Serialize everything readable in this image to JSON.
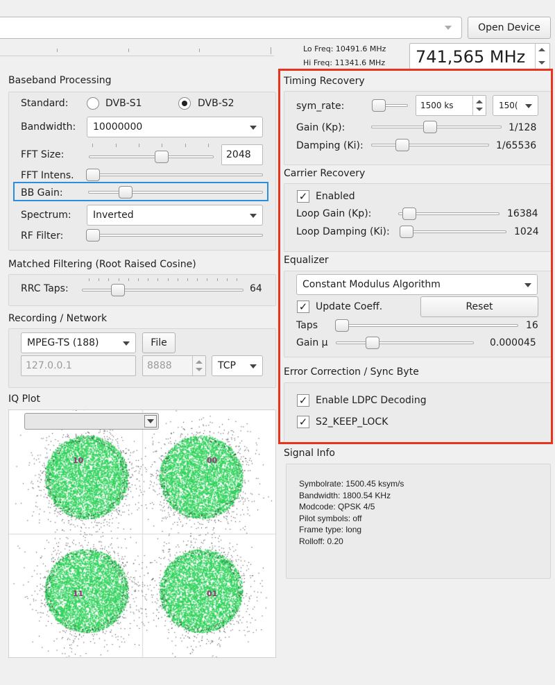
{
  "toolbar": {
    "open_device": "Open Device"
  },
  "freq": {
    "lo": "Lo Freq: 10491.6 MHz",
    "hi": "Hi Freq: 11341.6 MHz",
    "value": "741,565 MHz"
  },
  "baseband": {
    "title": "Baseband Processing",
    "standard_label": "Standard:",
    "dvbs1": "DVB-S1",
    "dvbs2": "DVB-S2",
    "selected_standard": "DVB-S2",
    "bandwidth_label": "Bandwidth:",
    "bandwidth_value": "10000000",
    "fft_size_label": "FFT Size:",
    "fft_size_value": "2048",
    "fft_intens_label": "FFT Intens.",
    "bb_gain_label": "BB Gain:",
    "spectrum_label": "Spectrum:",
    "spectrum_value": "Inverted",
    "rf_filter_label": "RF Filter:"
  },
  "matched": {
    "title": "Matched Filtering (Root Raised Cosine)",
    "rrc_label": "RRC Taps:",
    "rrc_value": "64"
  },
  "recording": {
    "title": "Recording / Network",
    "format": "MPEG-TS (188)",
    "file_button": "File",
    "ip": "127.0.0.1",
    "port": "8888",
    "protocol": "TCP"
  },
  "iq": {
    "title": "IQ Plot",
    "labels": [
      "10",
      "00",
      "11",
      "01"
    ]
  },
  "timing": {
    "title": "Timing Recovery",
    "sym_rate_label": "sym_rate:",
    "sym_rate_value": "1500 ks",
    "sym_rate_combo": "150(",
    "gain_label": "Gain (Kp):",
    "gain_value": "1/128",
    "damping_label": "Damping (Ki):",
    "damping_value": "1/65536"
  },
  "carrier": {
    "title": "Carrier Recovery",
    "enabled_label": "Enabled",
    "loop_gain_label": "Loop Gain (Kp):",
    "loop_gain_value": "16384",
    "loop_damping_label": "Loop Damping (Ki):",
    "loop_damping_value": "1024"
  },
  "equalizer": {
    "title": "Equalizer",
    "algorithm": "Constant Modulus Algorithm",
    "update_label": "Update Coeff.",
    "reset_button": "Reset",
    "taps_label": "Taps",
    "taps_value": "16",
    "gain_label": "Gain μ",
    "gain_value": "0.000045"
  },
  "errorcorr": {
    "title": "Error Correction / Sync Byte",
    "ldpc_label": "Enable LDPC Decoding",
    "keep_lock_label": "S2_KEEP_LOCK"
  },
  "signal_info": {
    "title": "Signal Info",
    "lines": [
      "Symbolrate: 1500.45 ksym/s",
      "Bandwidth: 1800.54 KHz",
      "Modcode: QPSK 4/5",
      "Pilot symbols: off",
      "Frame type: long",
      "Rolloff: 0.20"
    ]
  },
  "colors": {
    "highlight_red": "#e8341c",
    "highlight_blue": "#2a8de0",
    "constellation": "#2ed35a"
  }
}
